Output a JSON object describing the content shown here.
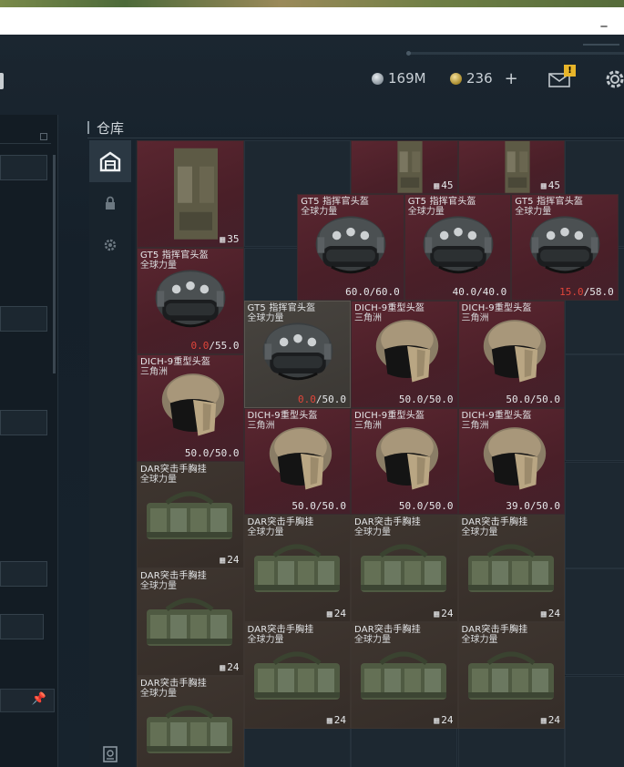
{
  "window": {
    "minimize_label": "_"
  },
  "topbar": {
    "currency_silver": "169M",
    "currency_gold": "236",
    "plus_label": "+",
    "mail_badge": "!"
  },
  "warehouse": {
    "title": "仓库",
    "tabs": [
      {
        "icon": "warehouse-icon",
        "active": true
      },
      {
        "icon": "lock-icon",
        "active": false
      },
      {
        "icon": "gear-icon",
        "active": false
      },
      {
        "icon": "safe-box-icon",
        "active": false
      }
    ]
  },
  "items": [
    {
      "kind": "vest",
      "name": "",
      "sub": "",
      "stat": "35",
      "stat_prefix": "",
      "color": "red"
    },
    {
      "kind": "vest",
      "name": "",
      "sub": "",
      "stat": "45",
      "stat_prefix": "",
      "color": "red"
    },
    {
      "kind": "vest",
      "name": "",
      "sub": "",
      "stat": "45",
      "stat_prefix": "",
      "color": "red"
    },
    {
      "kind": "helmet",
      "name": "GT5 指挥官头盔",
      "sub": "全球力量",
      "stat_low": "",
      "stat": "60.0/60.0",
      "color": "red"
    },
    {
      "kind": "helmet",
      "name": "GT5 指挥官头盔",
      "sub": "全球力量",
      "stat_low": "",
      "stat": "40.0/40.0",
      "color": "red"
    },
    {
      "kind": "helmet",
      "name": "GT5 指挥官头盔",
      "sub": "全球力量",
      "stat_low": "15.0",
      "stat": "/58.0",
      "color": "red"
    },
    {
      "kind": "helmet",
      "name": "GT5 指挥官头盔",
      "sub": "全球力量",
      "stat_low": "0.0",
      "stat": "/55.0",
      "color": "red"
    },
    {
      "kind": "helmet",
      "name": "GT5 指挥官头盔",
      "sub": "全球力量",
      "stat_low": "0.0",
      "stat": "/50.0",
      "color": "grey"
    },
    {
      "kind": "dich",
      "name": "DICH-9重型头盔",
      "sub": "三角洲",
      "stat_low": "",
      "stat": "50.0/50.0",
      "color": "red"
    },
    {
      "kind": "dich",
      "name": "DICH-9重型头盔",
      "sub": "三角洲",
      "stat_low": "",
      "stat": "50.0/50.0",
      "color": "red"
    },
    {
      "kind": "dich",
      "name": "DICH-9重型头盔",
      "sub": "三角洲",
      "stat_low": "",
      "stat": "50.0/50.0",
      "color": "red"
    },
    {
      "kind": "dich",
      "name": "DICH-9重型头盔",
      "sub": "三角洲",
      "stat_low": "",
      "stat": "50.0/50.0",
      "color": "red"
    },
    {
      "kind": "dich",
      "name": "DICH-9重型头盔",
      "sub": "三角洲",
      "stat_low": "",
      "stat": "50.0/50.0",
      "color": "red"
    },
    {
      "kind": "dich",
      "name": "DICH-9重型头盔",
      "sub": "三角洲",
      "stat_low": "",
      "stat": "39.0/50.0",
      "color": "red"
    },
    {
      "kind": "rig",
      "name": "DAR突击手胸挂",
      "sub": "全球力量",
      "stat": "24",
      "color": "brown"
    },
    {
      "kind": "rig",
      "name": "DAR突击手胸挂",
      "sub": "全球力量",
      "stat": "24",
      "color": "brown"
    },
    {
      "kind": "rig",
      "name": "DAR突击手胸挂",
      "sub": "全球力量",
      "stat": "24",
      "color": "brown"
    },
    {
      "kind": "rig",
      "name": "DAR突击手胸挂",
      "sub": "全球力量",
      "stat": "24",
      "color": "brown"
    },
    {
      "kind": "rig",
      "name": "DAR突击手胸挂",
      "sub": "全球力量",
      "stat": "24",
      "color": "brown"
    },
    {
      "kind": "rig",
      "name": "DAR突击手胸挂",
      "sub": "全球力量",
      "stat": "24",
      "color": "brown"
    },
    {
      "kind": "rig",
      "name": "DAR突击手胸挂",
      "sub": "全球力量",
      "stat": "24",
      "color": "brown"
    },
    {
      "kind": "rig",
      "name": "DAR突击手胸挂",
      "sub": "全球力量",
      "stat": "24",
      "color": "brown"
    },
    {
      "kind": "rig",
      "name": "DAR突击手胸挂",
      "sub": "全球力量",
      "stat": "",
      "color": "brown"
    }
  ],
  "colors": {
    "item_red": "#4f2129",
    "item_brown": "#3a312b",
    "low_durability": "#e0453a",
    "badge_yellow": "#e8b52a"
  }
}
